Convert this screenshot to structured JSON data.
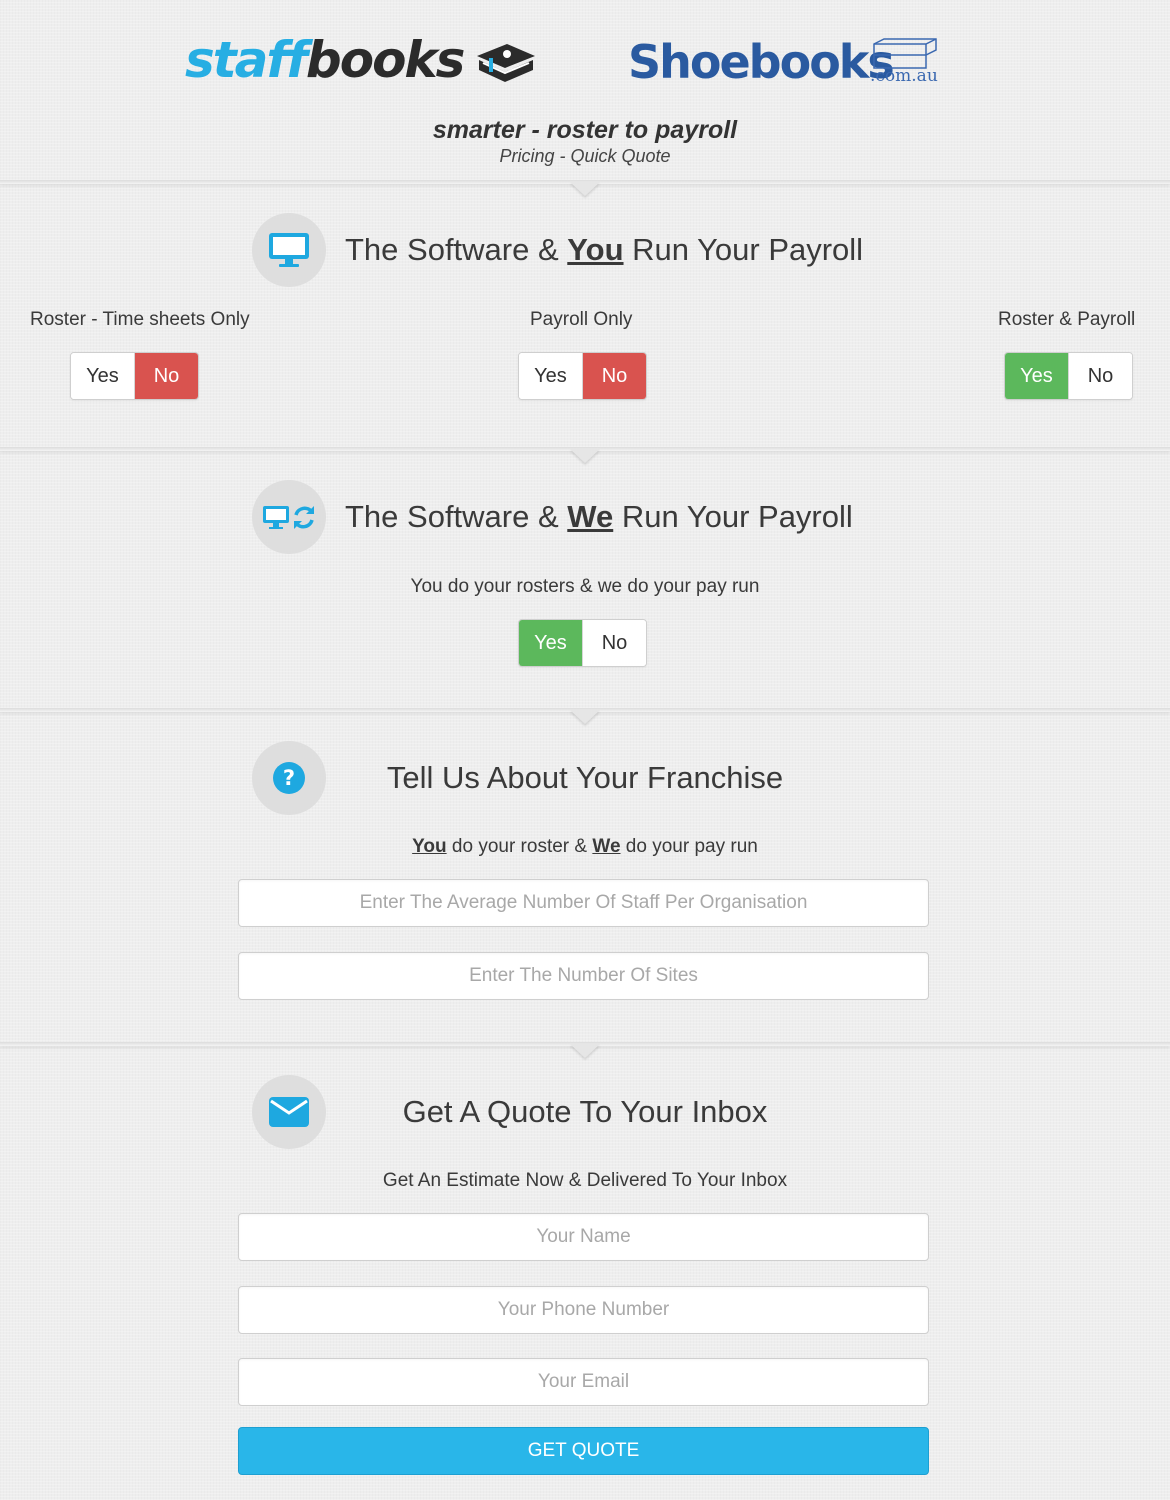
{
  "header": {
    "logo_staff_part1": "staff",
    "logo_staff_part2": "books",
    "logo_shoe_word": "Shoebooks",
    "logo_shoe_domain": ".com.au",
    "tagline": "smarter - roster to payroll",
    "subtitle": "Pricing - Quick Quote"
  },
  "colors": {
    "brand_blue": "#27aee3",
    "shoebooks_blue": "#2a5aa0",
    "yes_green": "#5cb85c",
    "no_red": "#d9534f",
    "button_blue": "#29b6e9"
  },
  "section1": {
    "icon": "monitor-icon",
    "title_pre": "The Software & ",
    "title_em": "You",
    "title_post": " Run Your Payroll",
    "options": [
      {
        "label": "Roster - Time sheets Only",
        "yes": "Yes",
        "no": "No",
        "selected": "No"
      },
      {
        "label": "Payroll Only",
        "yes": "Yes",
        "no": "No",
        "selected": "No"
      },
      {
        "label": "Roster & Payroll",
        "yes": "Yes",
        "no": "No",
        "selected": "Yes"
      }
    ]
  },
  "section2": {
    "icon": "monitor-refresh-icon",
    "title_pre": "The Software & ",
    "title_em": "We",
    "title_post": " Run Your Payroll",
    "label": "You do your rosters & we do your pay run",
    "yes": "Yes",
    "no": "No",
    "selected": "Yes"
  },
  "section3": {
    "icon": "question-icon",
    "title": "Tell Us About Your Franchise",
    "sub_you": "You",
    "sub_mid": " do your roster & ",
    "sub_we": "We",
    "sub_post": " do your pay run",
    "staff_placeholder": "Enter The Average Number Of Staff Per Organisation",
    "sites_placeholder": "Enter The Number Of Sites"
  },
  "section4": {
    "icon": "envelope-icon",
    "title": "Get A Quote To Your Inbox",
    "label": "Get An Estimate Now & Delivered To Your Inbox",
    "name_placeholder": "Your Name",
    "phone_placeholder": "Your Phone Number",
    "email_placeholder": "Your Email",
    "button": "GET QUOTE"
  }
}
